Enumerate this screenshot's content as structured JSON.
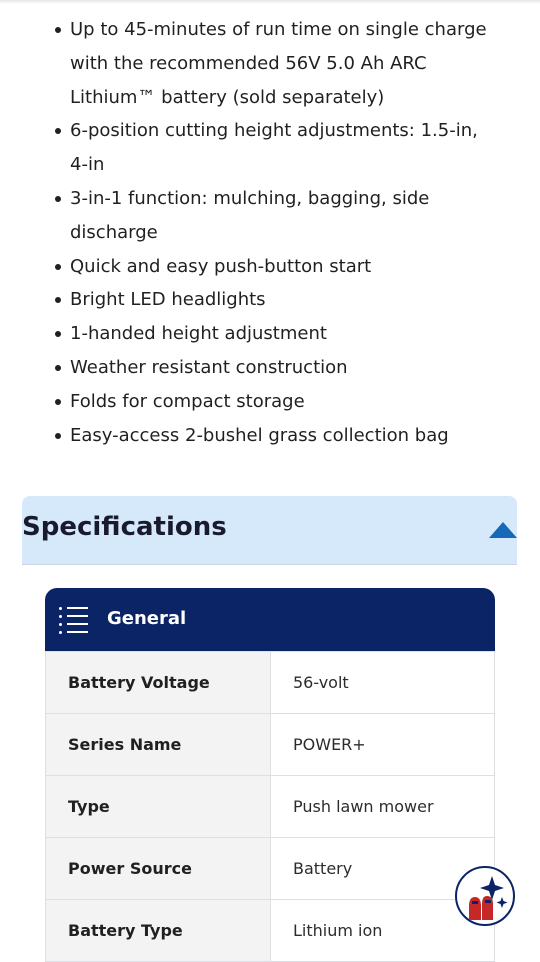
{
  "features": [
    "Up to 45-minutes of run time on single charge with the recommended 56V 5.0 Ah ARC Lithium™ battery (sold separately)",
    "6-position cutting height adjustments: 1.5-in, 4-in",
    "3-in-1 function: mulching, bagging, side discharge",
    "Quick and easy push-button start",
    "Bright LED headlights",
    "1-handed height adjustment",
    "Weather resistant construction",
    "Folds for compact storage",
    "Easy-access 2-bushel grass collection bag"
  ],
  "specifications": {
    "title": "Specifications",
    "toggle_icon": "caret-up-icon",
    "section": {
      "icon": "list-icon",
      "title": "General",
      "rows": [
        {
          "label": "Battery Voltage",
          "value": "56-volt"
        },
        {
          "label": "Series Name",
          "value": "POWER+"
        },
        {
          "label": "Type",
          "value": "Push lawn mower"
        },
        {
          "label": "Power Source",
          "value": "Battery"
        },
        {
          "label": "Battery Type",
          "value": "Lithium ion"
        }
      ]
    }
  },
  "assistant_button": {
    "icon": "sparkle-assistant-icon"
  },
  "colors": {
    "header_bg": "#d5e9fb",
    "card_header": "#0a2466",
    "caret": "#1669b8",
    "label_cell": "#f3f3f4",
    "assistant_red": "#c62828"
  }
}
